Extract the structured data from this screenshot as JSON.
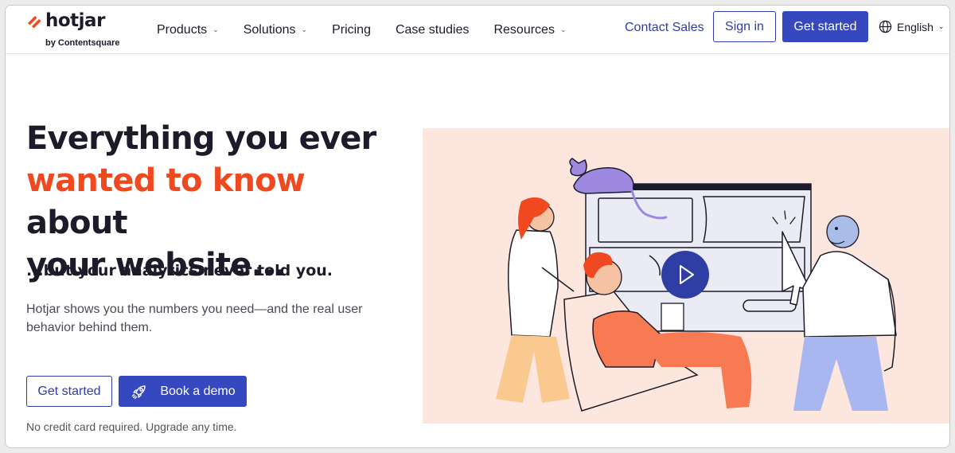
{
  "header": {
    "logo_word": "hotjar",
    "logo_sub": "by Contentsquare",
    "nav": [
      {
        "label": "Products",
        "has_dropdown": true
      },
      {
        "label": "Solutions",
        "has_dropdown": true
      },
      {
        "label": "Pricing",
        "has_dropdown": false
      },
      {
        "label": "Case studies",
        "has_dropdown": false
      },
      {
        "label": "Resources",
        "has_dropdown": true
      }
    ],
    "contact_label": "Contact Sales",
    "signin_label": "Sign in",
    "getstarted_label": "Get started",
    "language": "English",
    "icons": {
      "logo": "hotjar-logo-icon",
      "language": "globe-icon",
      "dropdown": "chevron-down-icon"
    }
  },
  "hero": {
    "title_part1": "Everything you ever",
    "title_accent": "wanted to know",
    "title_part2": " about",
    "title_part3": "your website...",
    "subtitle": "...but your analytics never told you.",
    "description": "Hotjar shows you the numbers you need—and the real user behavior behind them.",
    "cta_primary": "Get started",
    "cta_demo": "Book a demo",
    "note": "No credit card required. Upgrade any time."
  },
  "illustration": {
    "icons": {
      "video": "play-icon",
      "demo": "rocket-icon"
    }
  },
  "colors": {
    "accent_orange": "#f0481f",
    "brand_blue": "#3548c0",
    "illustration_bg": "#fde6de",
    "text_dark": "#1b1b2a"
  }
}
